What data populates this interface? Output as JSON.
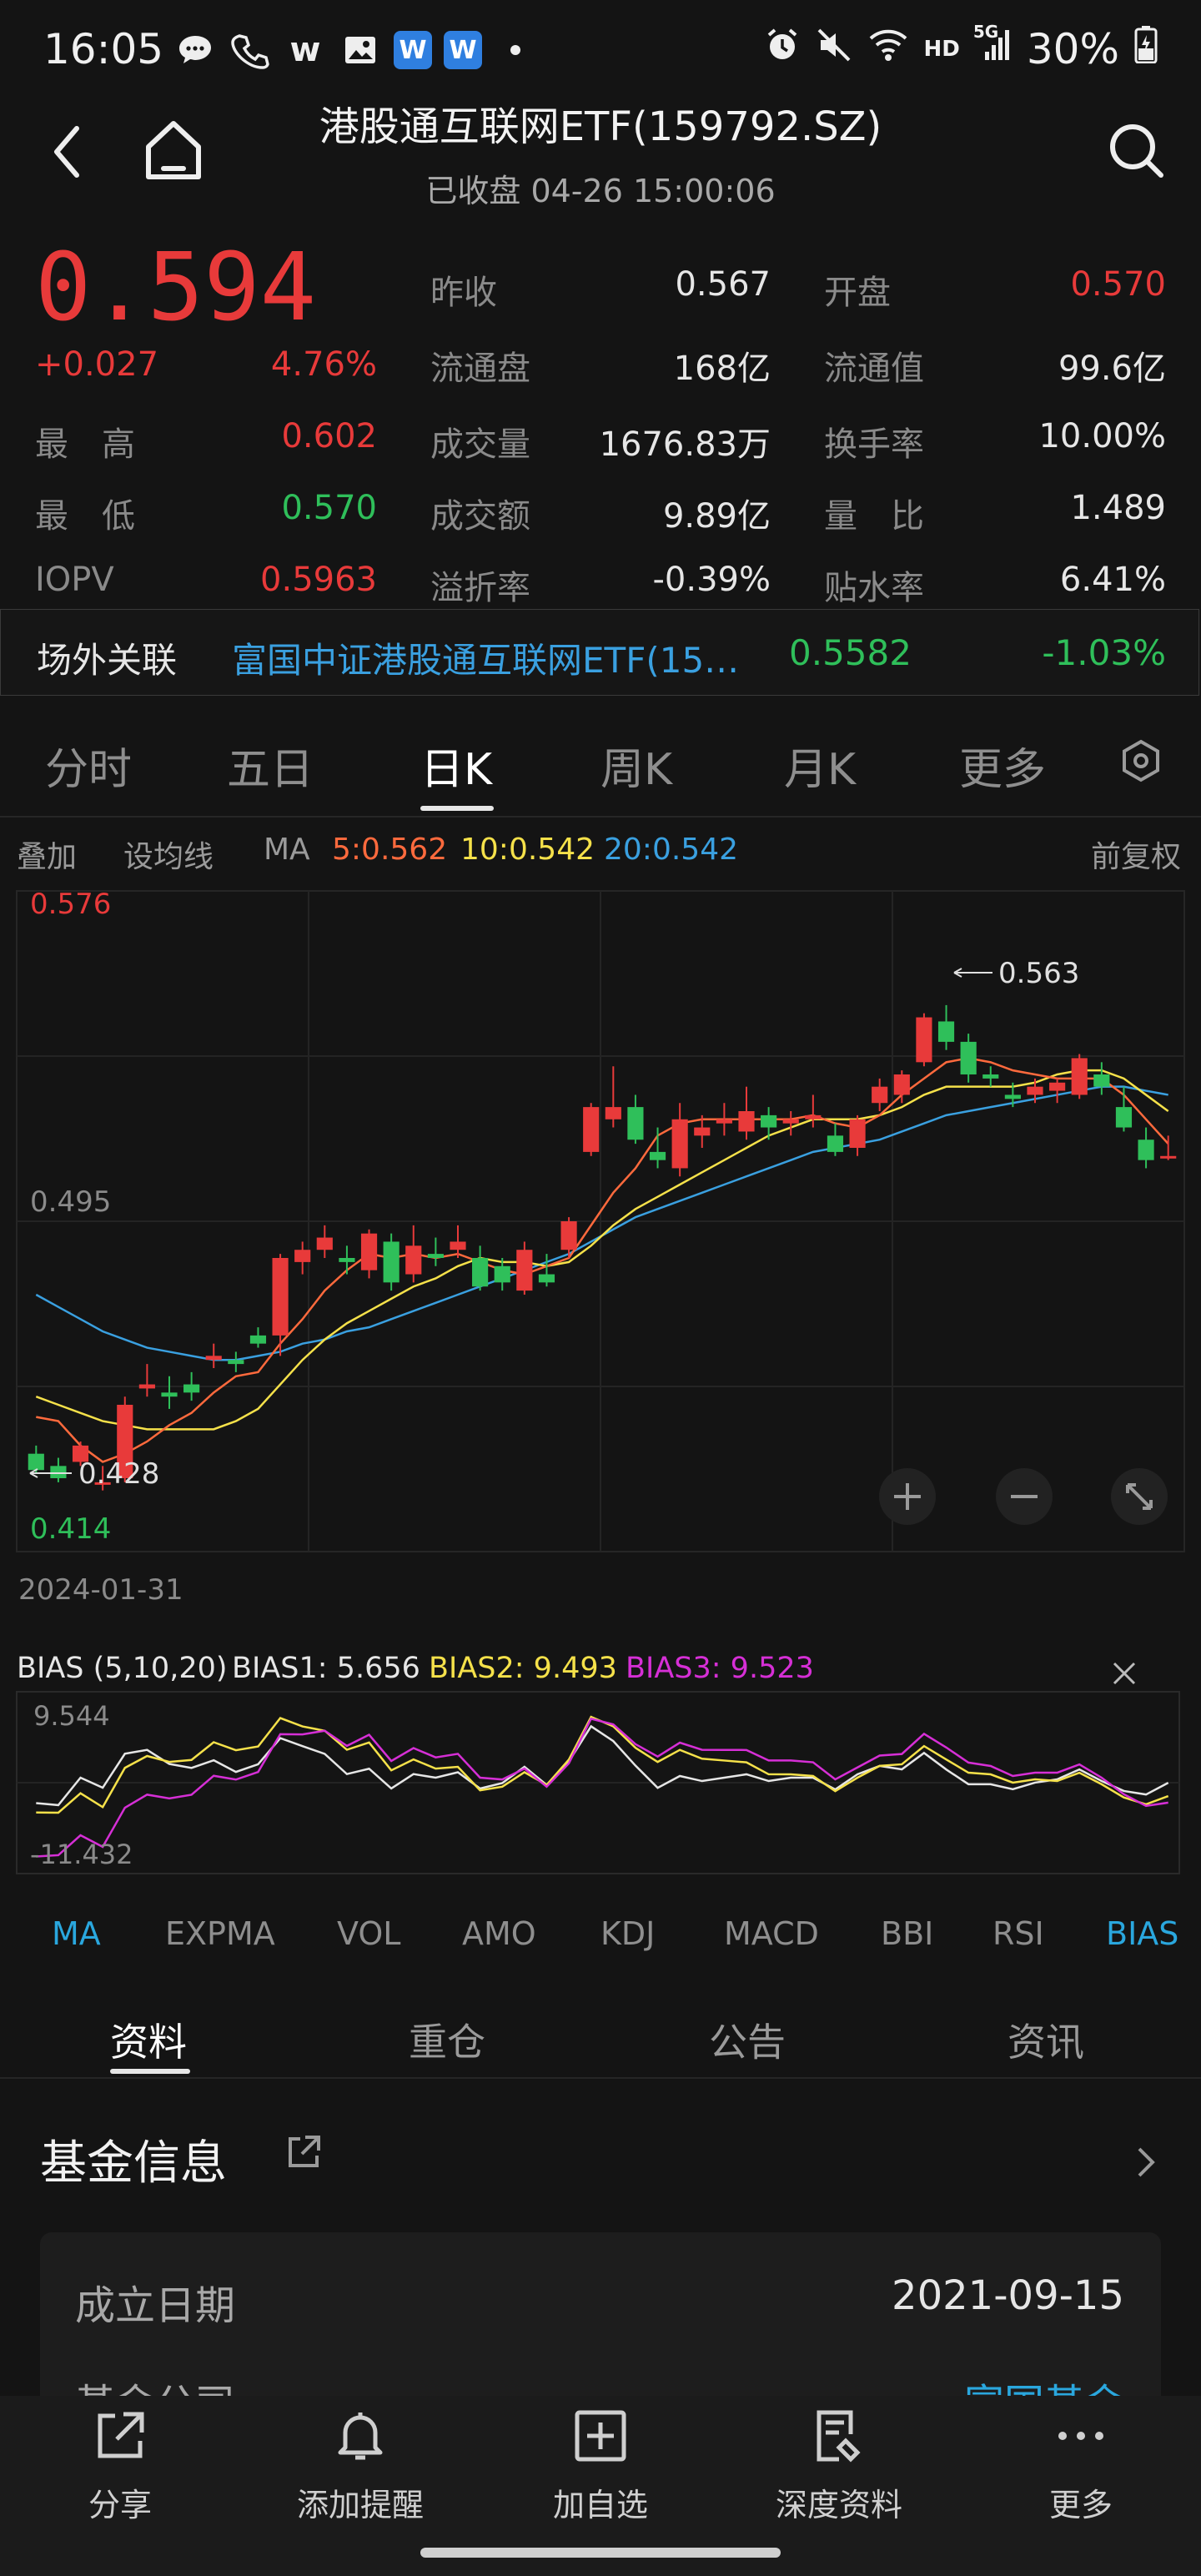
{
  "status": {
    "time": "16:05",
    "battery": "30%",
    "hd": "HD",
    "net": "5G"
  },
  "header": {
    "title": "港股通互联网ETF(159792.SZ)",
    "subtitle": "已收盘 04-26 15:00:06"
  },
  "quote": {
    "price": "0.594",
    "change": "+0.027",
    "change_pct": "4.76%",
    "left": [
      {
        "label": "最　高",
        "value": "0.602"
      },
      {
        "label": "最　低",
        "value": "0.570"
      },
      {
        "label": "IOPV",
        "value": "0.5963"
      }
    ],
    "mid": [
      {
        "label": "昨收",
        "value": "0.567"
      },
      {
        "label": "流通盘",
        "value": "168亿"
      },
      {
        "label": "成交量",
        "value": "1676.83万"
      },
      {
        "label": "成交额",
        "value": "9.89亿"
      },
      {
        "label": "溢折率",
        "value": "-0.39%"
      }
    ],
    "right": [
      {
        "label": "开盘",
        "value": "0.570"
      },
      {
        "label": "流通值",
        "value": "99.6亿"
      },
      {
        "label": "换手率",
        "value": "10.00%"
      },
      {
        "label": "量　比",
        "value": "1.489"
      },
      {
        "label": "贴水率",
        "value": "6.41%"
      }
    ]
  },
  "related": {
    "label": "场外关联",
    "name": "富国中证港股通互联网ETF(15…",
    "price": "0.5582",
    "pct": "-1.03%"
  },
  "period_tabs": [
    "分时",
    "五日",
    "日K",
    "周K",
    "月K",
    "更多"
  ],
  "legend": {
    "overlay": "叠加",
    "set_ma": "设均线",
    "ma": "MA",
    "ma5": "5:0.562",
    "ma10": "10:0.542",
    "ma20": "20:0.542",
    "adjust": "前复权"
  },
  "chart_labels": {
    "top": "0.576",
    "mid": "0.495",
    "bottom": "0.414",
    "high_mark": "0.563",
    "low_mark": "0.428",
    "date": "2024-01-31"
  },
  "bias": {
    "title": "BIAS (5,10,20)",
    "b1": "BIAS1: 5.656",
    "b2": "BIAS2: 9.493",
    "b3": "BIAS3: 9.523",
    "top": "9.544",
    "bottom": "-11.432"
  },
  "indicator_tabs": [
    "MA",
    "EXPMA",
    "VOL",
    "AMO",
    "KDJ",
    "MACD",
    "BBI",
    "RSI",
    "BIAS"
  ],
  "info_tabs": [
    "资料",
    "重仓",
    "公告",
    "资讯"
  ],
  "fund_info": {
    "title": "基金信息",
    "est_label": "成立日期",
    "est_value": "2021-09-15",
    "company_label": "基金公司",
    "company_value": "富国基金"
  },
  "nav": [
    "分享",
    "添加提醒",
    "加自选",
    "深度资料",
    "更多"
  ],
  "colors": {
    "up": "#e83a3a",
    "down": "#2fbf5a",
    "ma5": "#ff6a3d",
    "ma10": "#f5e14a",
    "ma20": "#3aa0e0",
    "bias3": "#d62fd6",
    "accent": "#2aa7de"
  },
  "chart_data": {
    "type": "candlestick",
    "ylim": [
      0.414,
      0.576
    ],
    "start_date": "2024-01-31",
    "ohlc": [
      [
        0.438,
        0.44,
        0.433,
        0.434
      ],
      [
        0.435,
        0.437,
        0.431,
        0.432
      ],
      [
        0.436,
        0.441,
        0.435,
        0.44
      ],
      [
        0.431,
        0.435,
        0.429,
        0.431
      ],
      [
        0.432,
        0.452,
        0.431,
        0.45
      ],
      [
        0.454,
        0.46,
        0.452,
        0.455
      ],
      [
        0.453,
        0.457,
        0.449,
        0.452
      ],
      [
        0.455,
        0.458,
        0.451,
        0.453
      ],
      [
        0.461,
        0.465,
        0.459,
        0.462
      ],
      [
        0.461,
        0.463,
        0.458,
        0.46
      ],
      [
        0.467,
        0.469,
        0.464,
        0.465
      ],
      [
        0.467,
        0.487,
        0.462,
        0.486
      ],
      [
        0.485,
        0.49,
        0.482,
        0.488
      ],
      [
        0.488,
        0.494,
        0.486,
        0.491
      ],
      [
        0.486,
        0.489,
        0.482,
        0.485
      ],
      [
        0.483,
        0.493,
        0.481,
        0.492
      ],
      [
        0.49,
        0.492,
        0.478,
        0.48
      ],
      [
        0.482,
        0.494,
        0.48,
        0.489
      ],
      [
        0.487,
        0.491,
        0.484,
        0.486
      ],
      [
        0.488,
        0.494,
        0.486,
        0.49
      ],
      [
        0.486,
        0.489,
        0.478,
        0.479
      ],
      [
        0.484,
        0.486,
        0.478,
        0.48
      ],
      [
        0.478,
        0.49,
        0.477,
        0.488
      ],
      [
        0.482,
        0.487,
        0.479,
        0.48
      ],
      [
        0.488,
        0.496,
        0.486,
        0.495
      ],
      [
        0.512,
        0.524,
        0.511,
        0.523
      ],
      [
        0.52,
        0.533,
        0.518,
        0.523
      ],
      [
        0.523,
        0.526,
        0.514,
        0.515
      ],
      [
        0.512,
        0.518,
        0.508,
        0.51
      ],
      [
        0.508,
        0.524,
        0.506,
        0.52
      ],
      [
        0.516,
        0.521,
        0.513,
        0.518
      ],
      [
        0.519,
        0.524,
        0.516,
        0.52
      ],
      [
        0.517,
        0.528,
        0.515,
        0.522
      ],
      [
        0.521,
        0.523,
        0.515,
        0.518
      ],
      [
        0.519,
        0.522,
        0.516,
        0.52
      ],
      [
        0.52,
        0.526,
        0.518,
        0.521
      ],
      [
        0.516,
        0.519,
        0.511,
        0.512
      ],
      [
        0.513,
        0.521,
        0.511,
        0.52
      ],
      [
        0.524,
        0.53,
        0.522,
        0.528
      ],
      [
        0.526,
        0.532,
        0.524,
        0.531
      ],
      [
        0.534,
        0.546,
        0.533,
        0.545
      ],
      [
        0.544,
        0.548,
        0.537,
        0.539
      ],
      [
        0.539,
        0.541,
        0.529,
        0.531
      ],
      [
        0.531,
        0.533,
        0.528,
        0.53
      ],
      [
        0.526,
        0.529,
        0.523,
        0.525
      ],
      [
        0.526,
        0.53,
        0.524,
        0.528
      ],
      [
        0.527,
        0.53,
        0.524,
        0.529
      ],
      [
        0.526,
        0.536,
        0.525,
        0.535
      ],
      [
        0.531,
        0.534,
        0.526,
        0.528
      ],
      [
        0.523,
        0.528,
        0.517,
        0.518
      ],
      [
        0.515,
        0.518,
        0.508,
        0.51
      ],
      [
        0.511,
        0.516,
        0.51,
        0.511
      ]
    ],
    "ma5": [
      0.447,
      0.446,
      0.44,
      0.436,
      0.438,
      0.441,
      0.445,
      0.448,
      0.453,
      0.457,
      0.458,
      0.465,
      0.471,
      0.478,
      0.483,
      0.487,
      0.486,
      0.487,
      0.486,
      0.487,
      0.485,
      0.483,
      0.482,
      0.484,
      0.486,
      0.494,
      0.502,
      0.508,
      0.516,
      0.519,
      0.52,
      0.52,
      0.52,
      0.52,
      0.52,
      0.521,
      0.519,
      0.518,
      0.521,
      0.526,
      0.53,
      0.534,
      0.535,
      0.534,
      0.532,
      0.531,
      0.53,
      0.53,
      0.53,
      0.526,
      0.52,
      0.514
    ],
    "ma10": [
      0.452,
      0.45,
      0.448,
      0.446,
      0.445,
      0.444,
      0.444,
      0.444,
      0.444,
      0.446,
      0.449,
      0.455,
      0.461,
      0.466,
      0.47,
      0.473,
      0.476,
      0.479,
      0.481,
      0.484,
      0.486,
      0.485,
      0.485,
      0.484,
      0.485,
      0.489,
      0.494,
      0.498,
      0.501,
      0.504,
      0.507,
      0.51,
      0.513,
      0.516,
      0.518,
      0.52,
      0.52,
      0.52,
      0.521,
      0.523,
      0.526,
      0.528,
      0.528,
      0.528,
      0.528,
      0.529,
      0.531,
      0.532,
      0.532,
      0.53,
      0.526,
      0.522
    ],
    "ma20": [
      0.477,
      0.474,
      0.471,
      0.468,
      0.466,
      0.464,
      0.463,
      0.462,
      0.461,
      0.461,
      0.462,
      0.463,
      0.465,
      0.466,
      0.468,
      0.469,
      0.471,
      0.473,
      0.475,
      0.477,
      0.479,
      0.481,
      0.483,
      0.485,
      0.487,
      0.49,
      0.493,
      0.496,
      0.498,
      0.5,
      0.502,
      0.504,
      0.506,
      0.508,
      0.51,
      0.512,
      0.513,
      0.514,
      0.515,
      0.517,
      0.519,
      0.521,
      0.522,
      0.523,
      0.524,
      0.525,
      0.526,
      0.527,
      0.528,
      0.528,
      0.527,
      0.526
    ]
  }
}
